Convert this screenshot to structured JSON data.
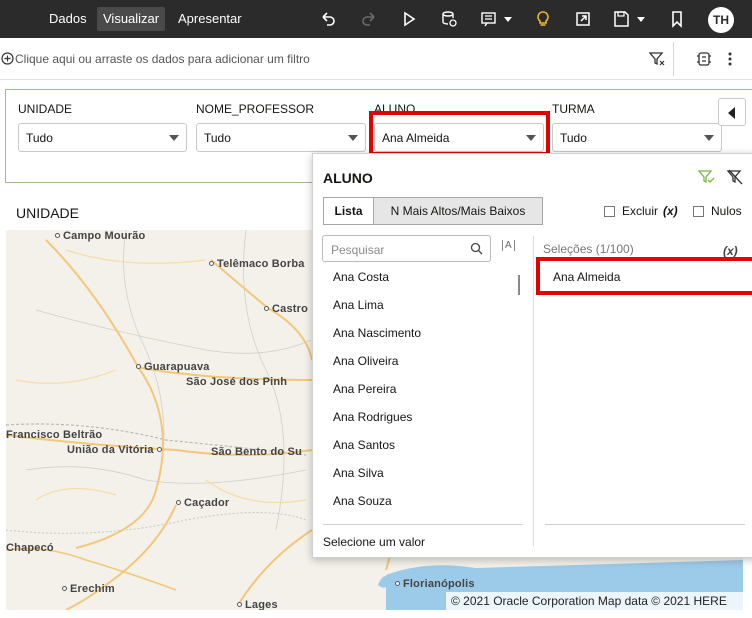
{
  "nav": {
    "tabs": [
      {
        "label": "Dados"
      },
      {
        "label": "Visualizar"
      },
      {
        "label": "Apresentar"
      }
    ],
    "toolbar_icons": [
      "undo-icon",
      "redo-icon",
      "play-icon",
      "data-refresh-icon",
      "comment-icon",
      "lightbulb-icon",
      "export-icon",
      "save-icon",
      "bookmark-icon"
    ],
    "avatar": "TH"
  },
  "filter_bar": {
    "hint": "Clique aqui ou arraste os dados para adicionar um filtro"
  },
  "filters": [
    {
      "label": "UNIDADE",
      "value": "Tudo"
    },
    {
      "label": "NOME_PROFESSOR",
      "value": "Tudo"
    },
    {
      "label": "ALUNO",
      "value": "Ana Almeida"
    },
    {
      "label": "TURMA",
      "value": "Tudo"
    }
  ],
  "section": {
    "title": "UNIDADE"
  },
  "map": {
    "cities": [
      {
        "name": "Campo Mourão"
      },
      {
        "name": "Telêmaco Borba"
      },
      {
        "name": "Castro"
      },
      {
        "name": "Guarapuava"
      },
      {
        "name": "São José dos Pinh"
      },
      {
        "name": "Francisco Beltrão"
      },
      {
        "name": "União da Vitória"
      },
      {
        "name": "São Bento do Su"
      },
      {
        "name": "Caçador"
      },
      {
        "name": "Chapecó"
      },
      {
        "name": "Erechim"
      },
      {
        "name": "Lages"
      },
      {
        "name": "Florianópolis"
      }
    ],
    "credits": "© 2021 Oracle Corporation   Map data © 2021 HERE",
    "colors": {
      "land": "#f4f1ea",
      "road": "#f3c77a",
      "border": "#b9b9b9",
      "water": "#9ccbe9"
    }
  },
  "popup": {
    "title": "ALUNO",
    "tabs": [
      {
        "label": "Lista"
      },
      {
        "label": "N Mais Altos/Mais Baixos"
      }
    ],
    "exclude_label": "Excluir",
    "exclude_x": "(x)",
    "nulls_label": "Nulos",
    "search_placeholder": "Pesquisar",
    "case_toggle": "A",
    "items": [
      "Ana Costa",
      "Ana Lima",
      "Ana Nascimento",
      "Ana Oliveira",
      "Ana Pereira",
      "Ana Rodrigues",
      "Ana Santos",
      "Ana Silva",
      "Ana Souza"
    ],
    "selections_header": "Seleções (1/100)",
    "selections_x": "(x)",
    "selected": [
      "Ana Almeida"
    ],
    "footer": "Selecione um valor"
  },
  "accent": {
    "highlight": "#e20000",
    "panel_border": "#9fbf8a",
    "topbar": "#2b2b2b"
  }
}
